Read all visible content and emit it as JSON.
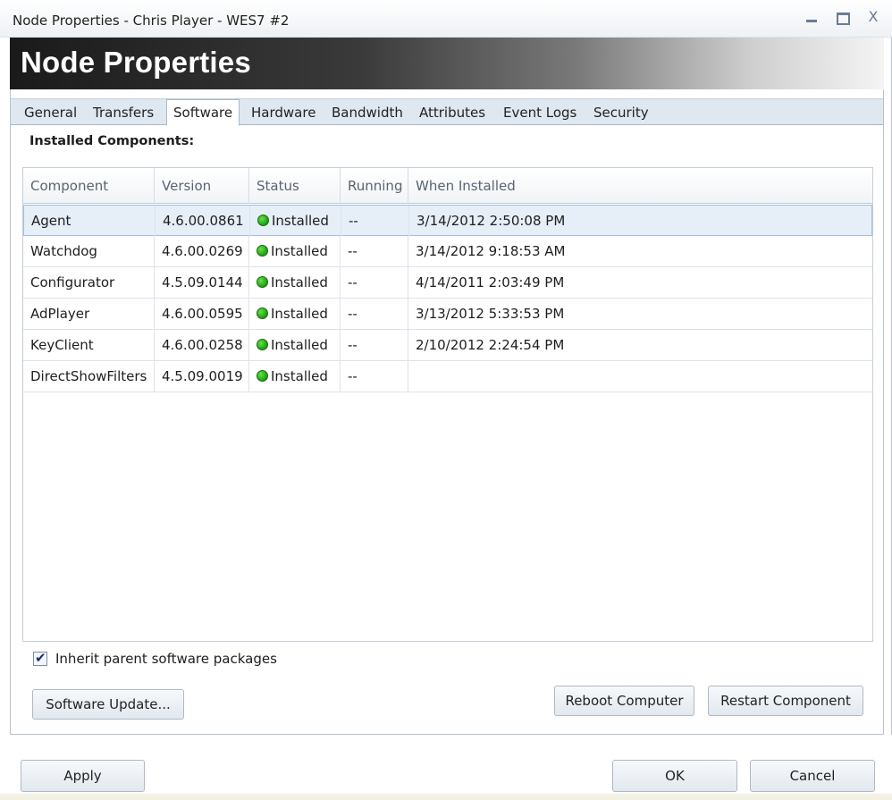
{
  "window": {
    "title": "Node Properties - Chris Player - WES7 #2",
    "controls": [
      "minimize-icon",
      "maximize-icon",
      "close-icon"
    ],
    "close_glyph": "X"
  },
  "banner": {
    "heading": "Node Properties"
  },
  "tabs": [
    {
      "label": "General",
      "active": false
    },
    {
      "label": "Transfers",
      "active": false
    },
    {
      "label": "Software",
      "active": true
    },
    {
      "label": "Hardware",
      "active": false
    },
    {
      "label": "Bandwidth",
      "active": false
    },
    {
      "label": "Attributes",
      "active": false
    },
    {
      "label": "Event Logs",
      "active": false
    },
    {
      "label": "Security",
      "active": false
    }
  ],
  "section_label": "Installed Components:",
  "grid": {
    "columns": [
      "Component",
      "Version",
      "Status",
      "Running",
      "When Installed"
    ],
    "rows": [
      {
        "component": "Agent",
        "version": "4.6.00.0861",
        "status": "Installed",
        "running": "--",
        "installed": "3/14/2012 2:50:08 PM"
      },
      {
        "component": "Watchdog",
        "version": "4.6.00.0269",
        "status": "Installed",
        "running": "--",
        "installed": "3/14/2012 9:18:53 AM"
      },
      {
        "component": "Configurator",
        "version": "4.5.09.0144",
        "status": "Installed",
        "running": "--",
        "installed": "4/14/2011 2:03:49 PM"
      },
      {
        "component": "AdPlayer",
        "version": "4.6.00.0595",
        "status": "Installed",
        "running": "--",
        "installed": "3/13/2012 5:33:53 PM"
      },
      {
        "component": "KeyClient",
        "version": "4.6.00.0258",
        "status": "Installed",
        "running": "--",
        "installed": "2/10/2012 2:24:54 PM"
      },
      {
        "component": "DirectShowFilters",
        "version": "4.5.09.0019",
        "status": "Installed",
        "running": "--",
        "installed": ""
      }
    ],
    "selected_row": 0,
    "status_color": "#22aa14"
  },
  "inherit": {
    "label": "Inherit parent software packages",
    "checked": true
  },
  "buttons": {
    "software_update": "Software Update...",
    "reboot": "Reboot Computer",
    "restart": "Restart Component",
    "apply": "Apply",
    "ok": "OK",
    "cancel": "Cancel"
  }
}
